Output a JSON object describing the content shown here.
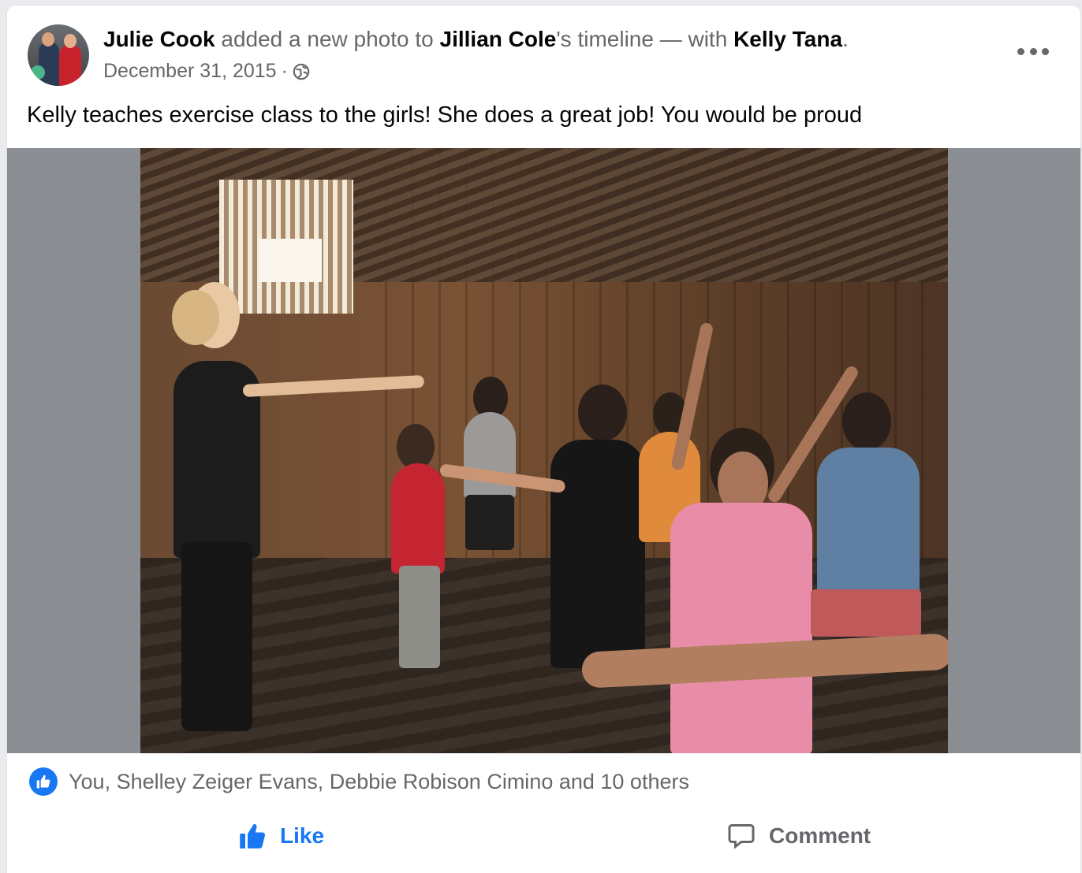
{
  "post": {
    "author": "Julie Cook",
    "action_text": " added a new photo to ",
    "target": "Jillian Cole",
    "target_suffix": "'s timeline — with ",
    "tagged": "Kelly Tana",
    "end_punct": ".",
    "date": "December 31, 2015",
    "separator": "·",
    "privacy_icon": "globe-icon",
    "more_icon": "more-options-icon",
    "caption": "Kelly teaches exercise class to the girls! She does a great job! You would be proud"
  },
  "reactions": {
    "icon": "like-reaction-icon",
    "summary": "You, Shelley Zeiger Evans, Debbie Robison Cimino and 10 others"
  },
  "actions": {
    "like_label": "Like",
    "comment_label": "Comment"
  },
  "colors": {
    "accent": "#1877f2",
    "secondary_text": "#65676b",
    "primary_text": "#050505",
    "media_background": "#8a8d91"
  }
}
